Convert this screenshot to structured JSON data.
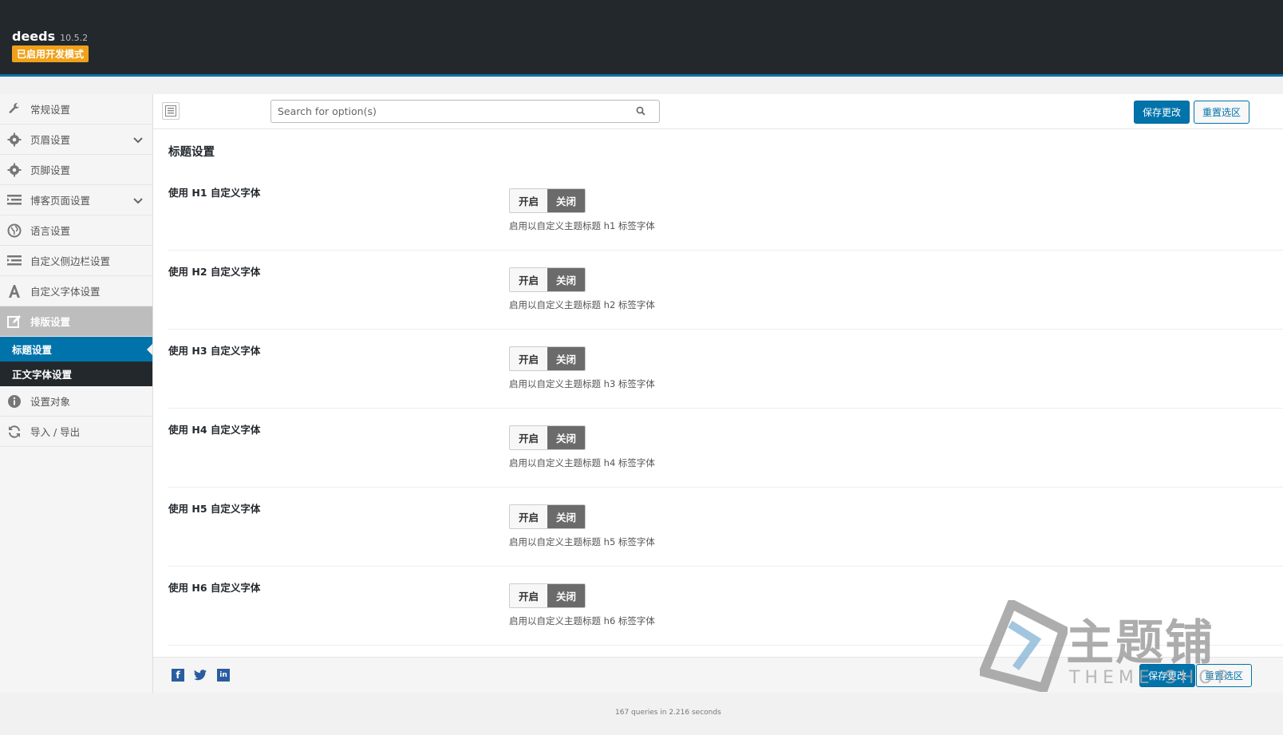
{
  "header": {
    "app_name": "deeds",
    "version": "10.5.2",
    "dev_mode_badge": "已启用开发模式",
    "accent_color": "#0073aa",
    "badge_color": "#f0a11a"
  },
  "sidebar": {
    "items": [
      {
        "label": "常规设置",
        "icon": "wrench-icon"
      },
      {
        "label": "页眉设置",
        "icon": "gear-icon",
        "expandable": true
      },
      {
        "label": "页脚设置",
        "icon": "gear-icon"
      },
      {
        "label": "博客页面设置",
        "icon": "list-icon",
        "expandable": true
      },
      {
        "label": "语言设置",
        "icon": "globe-icon"
      },
      {
        "label": "自定义侧边栏设置",
        "icon": "list-icon"
      },
      {
        "label": "自定义字体设置",
        "icon": "font-icon"
      },
      {
        "label": "排版设置",
        "icon": "edit-icon",
        "active": true
      }
    ],
    "subitems": [
      {
        "label": "标题设置",
        "current": true
      },
      {
        "label": "正文字体设置"
      }
    ],
    "bottom_items": [
      {
        "label": "设置对象",
        "icon": "info-icon"
      },
      {
        "label": "导入 / 导出",
        "icon": "refresh-icon"
      }
    ]
  },
  "toolbar": {
    "search_placeholder": "Search for option(s)",
    "save_label": "保存更改",
    "reset_label": "重置选区"
  },
  "main": {
    "section_title": "标题设置",
    "fields": [
      {
        "label": "使用 H1 自定义字体",
        "on": "开启",
        "off": "关闭",
        "desc": "启用以自定义主题标题 h1 标签字体",
        "state": "off"
      },
      {
        "label": "使用 H2 自定义字体",
        "on": "开启",
        "off": "关闭",
        "desc": "启用以自定义主题标题 h2 标签字体",
        "state": "off"
      },
      {
        "label": "使用 H3 自定义字体",
        "on": "开启",
        "off": "关闭",
        "desc": "启用以自定义主题标题 h3 标签字体",
        "state": "off"
      },
      {
        "label": "使用 H4 自定义字体",
        "on": "开启",
        "off": "关闭",
        "desc": "启用以自定义主题标题 h4 标签字体",
        "state": "off"
      },
      {
        "label": "使用 H5 自定义字体",
        "on": "开启",
        "off": "关闭",
        "desc": "启用以自定义主题标题 h5 标签字体",
        "state": "off"
      },
      {
        "label": "使用 H6 自定义字体",
        "on": "开启",
        "off": "关闭",
        "desc": "启用以自定义主题标题 h6 标签字体",
        "state": "off"
      }
    ]
  },
  "footer": {
    "save_label": "保存更改",
    "reset_label": "重置选区",
    "social": [
      "facebook-icon",
      "twitter-icon",
      "linkedin-icon"
    ],
    "status": "167 queries in 2.216 seconds"
  },
  "watermark": {
    "text": "主题铺",
    "sub": "THEME SHOP"
  }
}
